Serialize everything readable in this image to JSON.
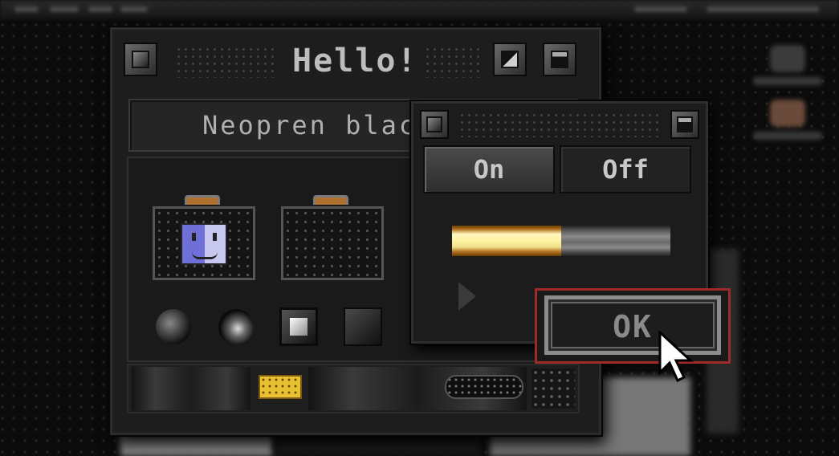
{
  "window": {
    "title": "Hello!"
  },
  "name_field": {
    "value": "Neopren black"
  },
  "toggle": {
    "on_label": "On",
    "off_label": "Off",
    "selected": "On"
  },
  "progress": {
    "fraction": 0.5
  },
  "ok_button": {
    "label": "OK"
  },
  "icons": {
    "close": "close-box-icon",
    "zoom": "zoom-box-icon",
    "collapse": "collapse-box-icon",
    "briefcase_finder": "finder-briefcase-icon",
    "briefcase_empty": "briefcase-icon",
    "cursor": "arrow-cursor-icon",
    "disclosure": "disclosure-triangle-icon"
  },
  "colors": {
    "highlight": "#9e2a2a",
    "progress_fill": "#fff2a0",
    "finder": "#6f6fd8"
  }
}
